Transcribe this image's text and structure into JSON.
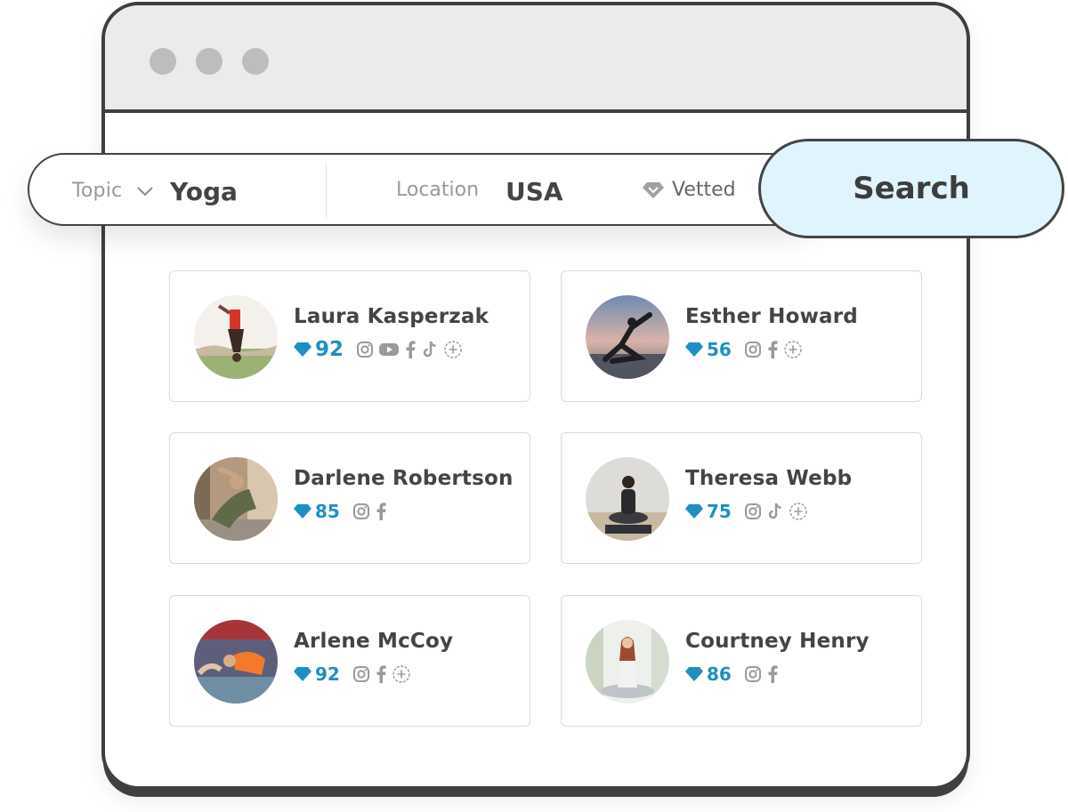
{
  "search": {
    "topic_label": "Topic",
    "topic_value": "Yoga",
    "location_label": "Location",
    "location_value": "USA",
    "vetted_label": "Vetted",
    "button_label": "Search"
  },
  "colors": {
    "accent": "#1e8fc3",
    "search_button_bg": "#dff4fc",
    "frame": "#3f3f3f"
  },
  "results": [
    {
      "name": "Laura Kasperzak",
      "score": "92",
      "socials": [
        "instagram-icon",
        "youtube-icon",
        "facebook-icon",
        "tiktok-icon",
        "more-icon"
      ]
    },
    {
      "name": "Esther Howard",
      "score": "56",
      "socials": [
        "instagram-icon",
        "facebook-icon",
        "more-icon"
      ]
    },
    {
      "name": "Darlene Robertson",
      "score": "85",
      "socials": [
        "instagram-icon",
        "facebook-icon"
      ]
    },
    {
      "name": "Theresa Webb",
      "score": "75",
      "socials": [
        "instagram-icon",
        "tiktok-icon",
        "more-icon"
      ]
    },
    {
      "name": "Arlene McCoy",
      "score": "92",
      "socials": [
        "instagram-icon",
        "facebook-icon",
        "more-icon"
      ]
    },
    {
      "name": "Courtney Henry",
      "score": "86",
      "socials": [
        "instagram-icon",
        "facebook-icon"
      ]
    }
  ]
}
